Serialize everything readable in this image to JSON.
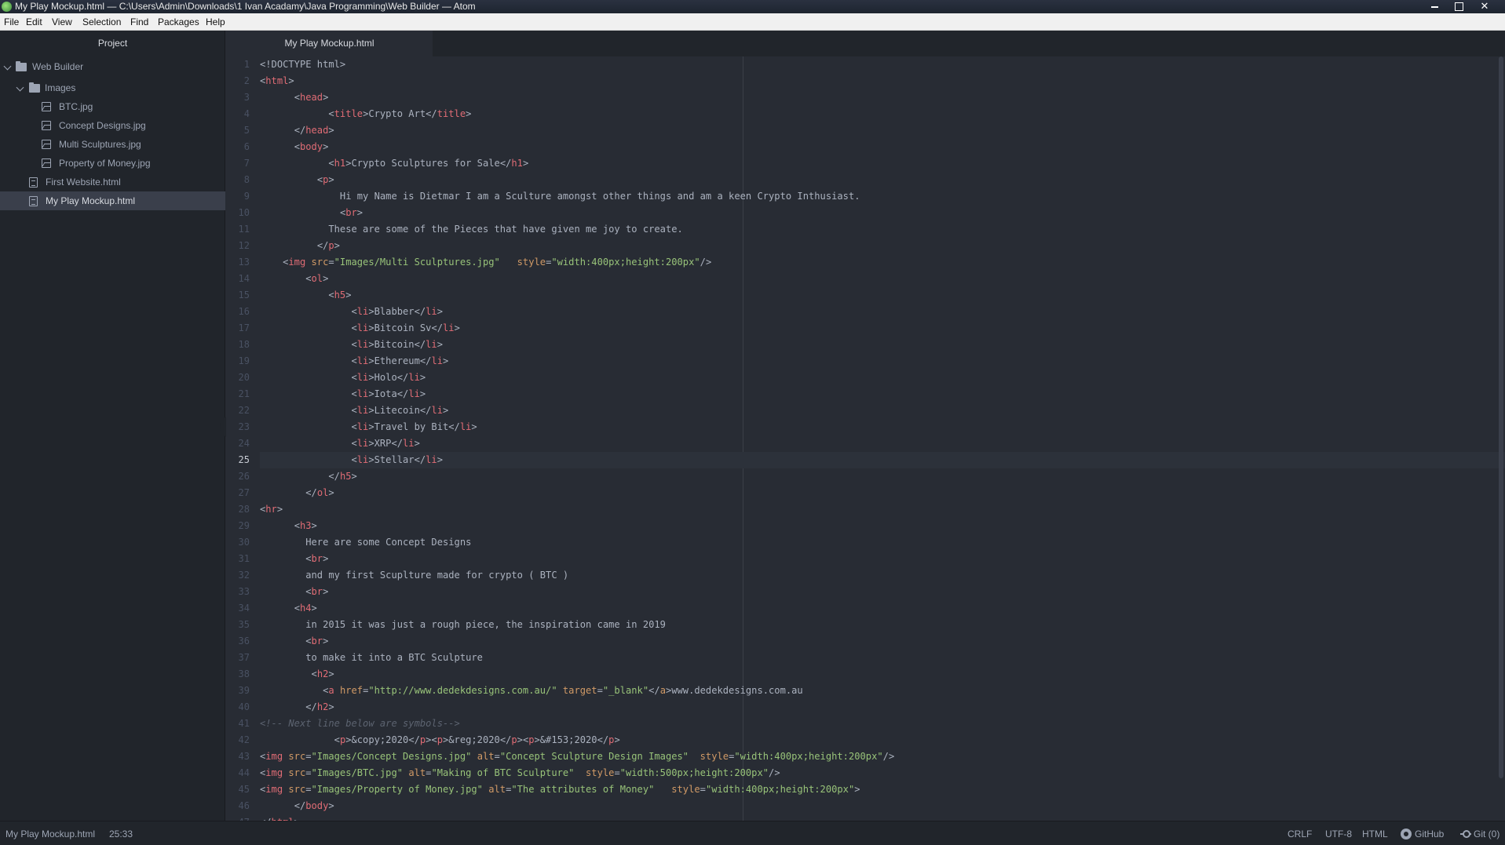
{
  "window": {
    "title": "My Play Mockup.html — C:\\Users\\Admin\\Downloads\\1 Ivan Acadamy\\Java Programming\\Web Builder — Atom"
  },
  "menu": [
    "File",
    "Edit",
    "View",
    "Selection",
    "Find",
    "Packages",
    "Help"
  ],
  "tree": {
    "header": "Project",
    "root": "Web Builder",
    "folder": "Images",
    "images": [
      "BTC.jpg",
      "Concept Designs.jpg",
      "Multi Sculptures.jpg",
      "Property of Money.jpg"
    ],
    "files": [
      "First Website.html",
      "My Play Mockup.html"
    ],
    "selected": "My Play Mockup.html"
  },
  "tab": {
    "label": "My Play Mockup.html"
  },
  "editor": {
    "active_line": 25,
    "lines": [
      "<!DOCTYPE html>",
      "<html>",
      "      <head>",
      "            <title>Crypto Art</title>",
      "      </head>",
      "      <body>",
      "            <h1>Crypto Sculptures for Sale</h1>",
      "          <p>",
      "              Hi my Name is Dietmar I am a Sculture amongst other things and am a keen Crypto Inthusiast.",
      "              <br>",
      "            These are some of the Pieces that have given me joy to create.",
      "          </p>",
      "    <img src=\"Images/Multi Sculptures.jpg\"   style=\"width:400px;height:200px\"/>",
      "        <ol>",
      "            <h5>",
      "                <li>Blabber</li>",
      "                <li>Bitcoin Sv</li>",
      "                <li>Bitcoin</li>",
      "                <li>Ethereum</li>",
      "                <li>Holo</li>",
      "                <li>Iota</li>",
      "                <li>Litecoin</li>",
      "                <li>Travel by Bit</li>",
      "                <li>XRP</li>",
      "                <li>Stellar</li>",
      "            </h5>",
      "        </ol>",
      "<hr>",
      "      <h3>",
      "        Here are some Concept Designs",
      "        <br>",
      "        and my first Scuplture made for crypto ( BTC )",
      "        <br>",
      "      <h4>",
      "        in 2015 it was just a rough piece, the inspiration came in 2019",
      "        <br>",
      "        to make it into a BTC Sculpture",
      "         <h2>",
      "           <a href=\"http://www.dedekdesigns.com.au/\" target=\"_blank\"</a>www.dedekdesigns.com.au",
      "        </h2>",
      "<!-- Next line below are symbols-->",
      "             <p>&copy;2020</p><p>&reg;2020</p><p>&#153;2020</p>",
      "<img src=\"Images/Concept Designs.jpg\" alt=\"Concept Sculpture Design Images\"  style=\"width:400px;height:200px\"/>",
      "<img src=\"Images/BTC.jpg\" alt=\"Making of BTC Sculpture\"  style=\"width:500px;height:200px\"/>",
      "<img src=\"Images/Property of Money.jpg\" alt=\"The attributes of Money\"   style=\"width:400px;height:200px\">",
      "      </body>",
      "</html>"
    ]
  },
  "status": {
    "file": "My Play Mockup.html",
    "cursor": "25:33",
    "line_ending": "CRLF",
    "encoding": "UTF-8",
    "grammar": "HTML",
    "github": "GitHub",
    "git": "Git (0)"
  },
  "colors": {
    "editor_bg": "#282c34",
    "panel_bg": "#21252b",
    "tag": "#e06c75",
    "attr": "#d19a66",
    "string": "#98c379",
    "comment": "#5c6370",
    "text": "#abb2bf"
  }
}
